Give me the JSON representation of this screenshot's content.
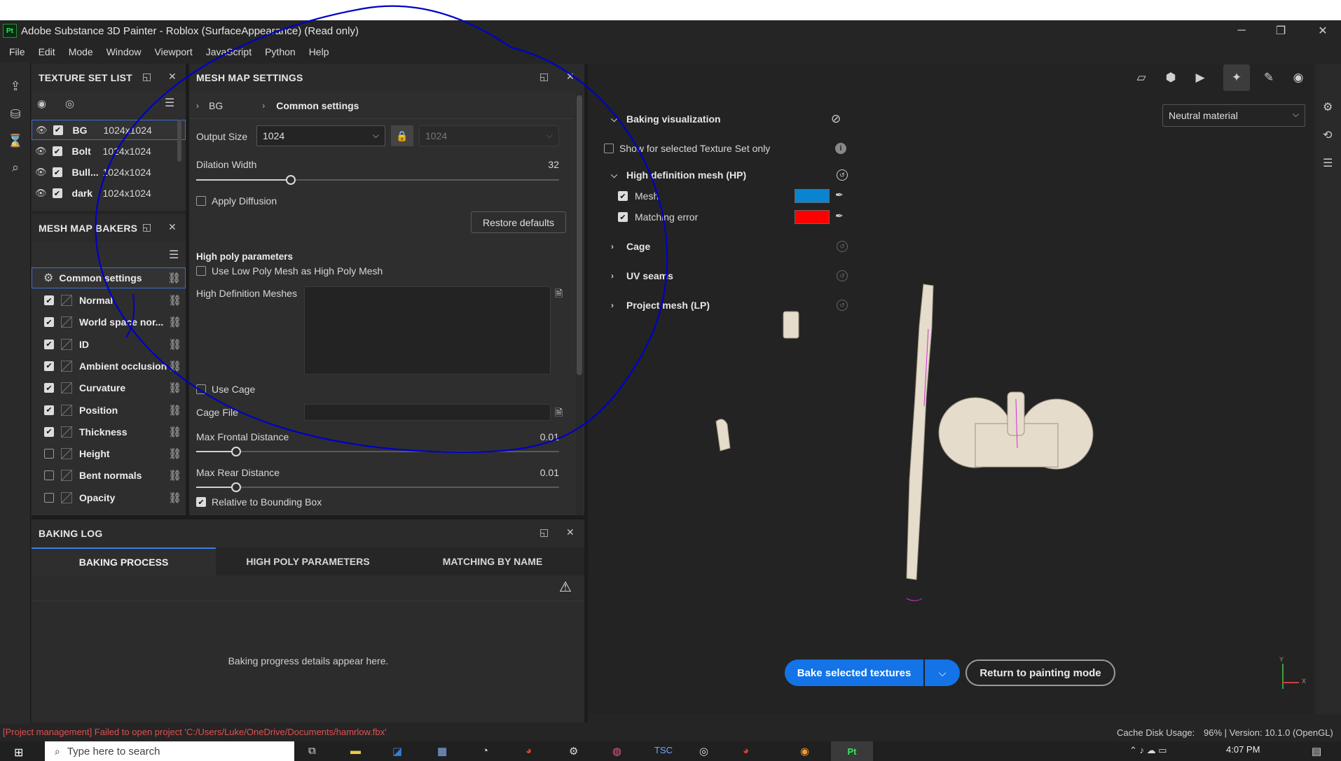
{
  "window": {
    "title": "Adobe Substance 3D Painter - Roblox (SurfaceAppearance) (Read only)",
    "logo": "Pt",
    "minimize": "─",
    "restore": "❐",
    "close": "✕"
  },
  "menu": [
    "File",
    "Edit",
    "Mode",
    "Window",
    "Viewport",
    "JavaScript",
    "Python",
    "Help"
  ],
  "texture_set_list": {
    "title": "TEXTURE SET LIST",
    "items": [
      {
        "name": "BG",
        "size": "1024x1024"
      },
      {
        "name": "Bolt",
        "size": "1024x1024"
      },
      {
        "name": "Bull...",
        "size": "1024x1024"
      },
      {
        "name": "dark",
        "size": "1024x1024"
      }
    ]
  },
  "mesh_map_bakers": {
    "title": "MESH MAP BAKERS",
    "common": "Common settings",
    "items": [
      {
        "label": "Normal",
        "checked": true
      },
      {
        "label": "World space nor...",
        "checked": true
      },
      {
        "label": "ID",
        "checked": true
      },
      {
        "label": "Ambient occlusion",
        "checked": true
      },
      {
        "label": "Curvature",
        "checked": true
      },
      {
        "label": "Position",
        "checked": true
      },
      {
        "label": "Thickness",
        "checked": true
      },
      {
        "label": "Height",
        "checked": false
      },
      {
        "label": "Bent normals",
        "checked": false
      },
      {
        "label": "Opacity",
        "checked": false
      }
    ]
  },
  "mesh_map_settings": {
    "title": "MESH MAP SETTINGS",
    "breadcrumb_bg": "BG",
    "breadcrumb_common": "Common settings",
    "output_size_label": "Output Size",
    "output_size": "1024",
    "output_size_locked": "1024",
    "dilation_label": "Dilation Width",
    "dilation_value": "32",
    "dilation_fraction": 0.26,
    "apply_diffusion": "Apply Diffusion",
    "restore_defaults": "Restore defaults",
    "high_poly_title": "High poly parameters",
    "use_low_poly": "Use Low Poly Mesh as High Poly Mesh",
    "hd_meshes_label": "High Definition Meshes",
    "use_cage": "Use Cage",
    "cage_file": "Cage File",
    "max_frontal_label": "Max Frontal Distance",
    "max_frontal_value": "0.01",
    "max_frontal_fraction": 0.11,
    "max_rear_label": "Max Rear Distance",
    "max_rear_value": "0.01",
    "max_rear_fraction": 0.11,
    "relative_bbox": "Relative to Bounding Box"
  },
  "baking_log": {
    "title": "BAKING LOG",
    "tabs": [
      "BAKING PROCESS",
      "HIGH POLY PARAMETERS",
      "MATCHING BY NAME"
    ],
    "empty": "Baking progress details appear here."
  },
  "viewport": {
    "material_dropdown": "Neutral material",
    "baking_visualization": "Baking visualization",
    "show_selected_only": "Show for selected Texture Set only",
    "hp_title": "High definition mesh (HP)",
    "mesh": "Mesh",
    "matching_error": "Matching error",
    "mesh_color": "#0a84d0",
    "error_color": "#ff0000",
    "cage": "Cage",
    "uv_seams": "UV seams",
    "project_mesh": "Project mesh (LP)",
    "bake_button": "Bake selected textures",
    "return_button": "Return to painting mode",
    "axis_y": "Y",
    "axis_x": "X"
  },
  "status": {
    "error": "[Project management] Failed to open project 'C:/Users/Luke/OneDrive/Documents/hamrlow.fbx'",
    "cache": "Cache Disk Usage:",
    "version": "96% | Version: 10.1.0 (OpenGL)"
  },
  "taskbar": {
    "search": "Type here to search",
    "time": "4:07 PM",
    "pinned_app": "Pt"
  },
  "colors": {
    "accent": "#1473e6",
    "annotation": "#0000c8"
  }
}
